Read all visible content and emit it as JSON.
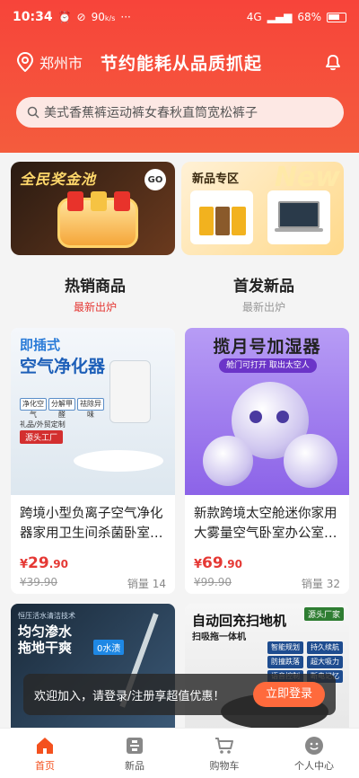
{
  "status_bar": {
    "time": "10:34",
    "network": "4G",
    "battery": "68%",
    "icons": [
      "alarm-icon",
      "mute-icon",
      "speed-icon",
      "more-icon"
    ],
    "speed_value": "90"
  },
  "header": {
    "city": "郑州市",
    "slogan": "节约能耗从品质抓起"
  },
  "search": {
    "placeholder": "美式香蕉裤运动裤女春秋直筒宽松裤子"
  },
  "banners": {
    "left": {
      "title": "全民奖金池",
      "badge": "GO"
    },
    "right": {
      "title": "新品专区",
      "watermark": "New"
    }
  },
  "tabs": [
    {
      "title": "热销商品",
      "sub": "最新出炉",
      "active": true
    },
    {
      "title": "首发新品",
      "sub": "最新出炉",
      "active": false
    }
  ],
  "products": [
    {
      "image_text": {
        "line1": "即插式",
        "line2": "空气净化器",
        "features": [
          "净化空气",
          "分解甲醛",
          "祛除异味"
        ],
        "tag1": "礼品/外贸定制",
        "tag2": "源头工厂"
      },
      "name": "跨境小型负离子空气净化器家用卫生间杀菌卧室…",
      "price_currency": "¥",
      "price_int": "29",
      "price_dec": ".90",
      "orig_price": "¥39.90",
      "sales": "销量 14"
    },
    {
      "image_text": {
        "title": "揽月号加湿器",
        "pill": "舱门可打开 取出太空人"
      },
      "name": "新款跨境太空舱迷你家用大雾量空气卧室办公室…",
      "price_currency": "¥",
      "price_int": "69",
      "price_dec": ".90",
      "orig_price": "¥99.90",
      "sales": "销量 32"
    },
    {
      "image_text": {
        "top": "恒压活水清洁技术",
        "line1": "均匀渗水",
        "line2": "拖地干爽",
        "badge": "0水渍"
      }
    },
    {
      "image_text": {
        "title": "自动回充扫地机",
        "subtitle": "扫吸拖一体机",
        "tag": "源头厂家",
        "features": [
          "智能规划",
          "持久续航",
          "防撞跌落",
          "超大吸力",
          "语音控制",
          "断电记忆"
        ]
      }
    }
  ],
  "login_toast": {
    "text": "欢迎加入，请登录/注册享超值优惠！",
    "button": "立即登录"
  },
  "bottom_nav": [
    {
      "label": "首页",
      "icon": "home-icon",
      "active": true
    },
    {
      "label": "新品",
      "icon": "new-products-icon",
      "active": false
    },
    {
      "label": "购物车",
      "icon": "cart-icon",
      "active": false
    },
    {
      "label": "个人中心",
      "icon": "profile-icon",
      "active": false
    }
  ],
  "colors": {
    "primary": "#f7443a",
    "price": "#e53935",
    "accent": "#ff6a3c"
  }
}
